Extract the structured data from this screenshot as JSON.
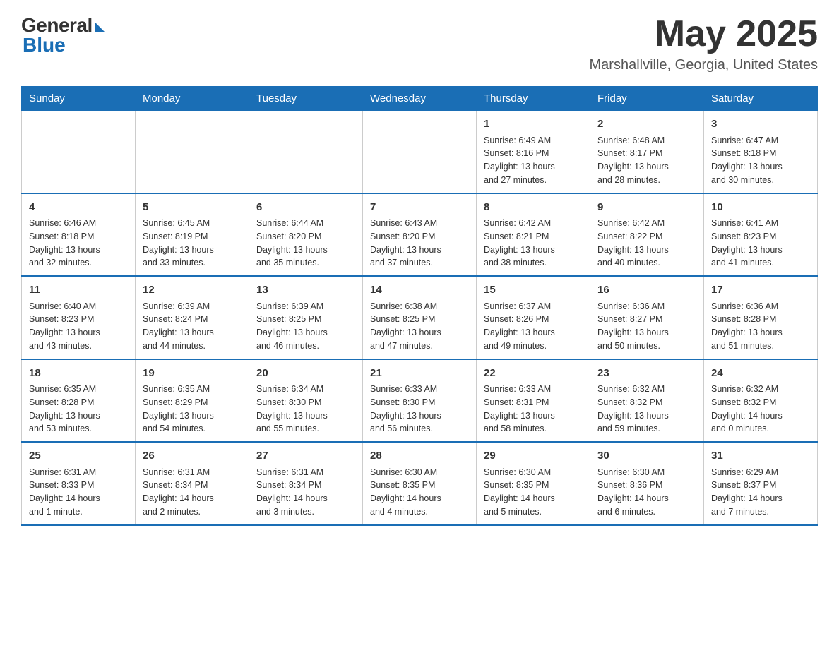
{
  "header": {
    "logo_general": "General",
    "logo_blue": "Blue",
    "month_year": "May 2025",
    "location": "Marshallville, Georgia, United States"
  },
  "days_of_week": [
    "Sunday",
    "Monday",
    "Tuesday",
    "Wednesday",
    "Thursday",
    "Friday",
    "Saturday"
  ],
  "weeks": [
    [
      {
        "day": "",
        "info": ""
      },
      {
        "day": "",
        "info": ""
      },
      {
        "day": "",
        "info": ""
      },
      {
        "day": "",
        "info": ""
      },
      {
        "day": "1",
        "info": "Sunrise: 6:49 AM\nSunset: 8:16 PM\nDaylight: 13 hours\nand 27 minutes."
      },
      {
        "day": "2",
        "info": "Sunrise: 6:48 AM\nSunset: 8:17 PM\nDaylight: 13 hours\nand 28 minutes."
      },
      {
        "day": "3",
        "info": "Sunrise: 6:47 AM\nSunset: 8:18 PM\nDaylight: 13 hours\nand 30 minutes."
      }
    ],
    [
      {
        "day": "4",
        "info": "Sunrise: 6:46 AM\nSunset: 8:18 PM\nDaylight: 13 hours\nand 32 minutes."
      },
      {
        "day": "5",
        "info": "Sunrise: 6:45 AM\nSunset: 8:19 PM\nDaylight: 13 hours\nand 33 minutes."
      },
      {
        "day": "6",
        "info": "Sunrise: 6:44 AM\nSunset: 8:20 PM\nDaylight: 13 hours\nand 35 minutes."
      },
      {
        "day": "7",
        "info": "Sunrise: 6:43 AM\nSunset: 8:20 PM\nDaylight: 13 hours\nand 37 minutes."
      },
      {
        "day": "8",
        "info": "Sunrise: 6:42 AM\nSunset: 8:21 PM\nDaylight: 13 hours\nand 38 minutes."
      },
      {
        "day": "9",
        "info": "Sunrise: 6:42 AM\nSunset: 8:22 PM\nDaylight: 13 hours\nand 40 minutes."
      },
      {
        "day": "10",
        "info": "Sunrise: 6:41 AM\nSunset: 8:23 PM\nDaylight: 13 hours\nand 41 minutes."
      }
    ],
    [
      {
        "day": "11",
        "info": "Sunrise: 6:40 AM\nSunset: 8:23 PM\nDaylight: 13 hours\nand 43 minutes."
      },
      {
        "day": "12",
        "info": "Sunrise: 6:39 AM\nSunset: 8:24 PM\nDaylight: 13 hours\nand 44 minutes."
      },
      {
        "day": "13",
        "info": "Sunrise: 6:39 AM\nSunset: 8:25 PM\nDaylight: 13 hours\nand 46 minutes."
      },
      {
        "day": "14",
        "info": "Sunrise: 6:38 AM\nSunset: 8:25 PM\nDaylight: 13 hours\nand 47 minutes."
      },
      {
        "day": "15",
        "info": "Sunrise: 6:37 AM\nSunset: 8:26 PM\nDaylight: 13 hours\nand 49 minutes."
      },
      {
        "day": "16",
        "info": "Sunrise: 6:36 AM\nSunset: 8:27 PM\nDaylight: 13 hours\nand 50 minutes."
      },
      {
        "day": "17",
        "info": "Sunrise: 6:36 AM\nSunset: 8:28 PM\nDaylight: 13 hours\nand 51 minutes."
      }
    ],
    [
      {
        "day": "18",
        "info": "Sunrise: 6:35 AM\nSunset: 8:28 PM\nDaylight: 13 hours\nand 53 minutes."
      },
      {
        "day": "19",
        "info": "Sunrise: 6:35 AM\nSunset: 8:29 PM\nDaylight: 13 hours\nand 54 minutes."
      },
      {
        "day": "20",
        "info": "Sunrise: 6:34 AM\nSunset: 8:30 PM\nDaylight: 13 hours\nand 55 minutes."
      },
      {
        "day": "21",
        "info": "Sunrise: 6:33 AM\nSunset: 8:30 PM\nDaylight: 13 hours\nand 56 minutes."
      },
      {
        "day": "22",
        "info": "Sunrise: 6:33 AM\nSunset: 8:31 PM\nDaylight: 13 hours\nand 58 minutes."
      },
      {
        "day": "23",
        "info": "Sunrise: 6:32 AM\nSunset: 8:32 PM\nDaylight: 13 hours\nand 59 minutes."
      },
      {
        "day": "24",
        "info": "Sunrise: 6:32 AM\nSunset: 8:32 PM\nDaylight: 14 hours\nand 0 minutes."
      }
    ],
    [
      {
        "day": "25",
        "info": "Sunrise: 6:31 AM\nSunset: 8:33 PM\nDaylight: 14 hours\nand 1 minute."
      },
      {
        "day": "26",
        "info": "Sunrise: 6:31 AM\nSunset: 8:34 PM\nDaylight: 14 hours\nand 2 minutes."
      },
      {
        "day": "27",
        "info": "Sunrise: 6:31 AM\nSunset: 8:34 PM\nDaylight: 14 hours\nand 3 minutes."
      },
      {
        "day": "28",
        "info": "Sunrise: 6:30 AM\nSunset: 8:35 PM\nDaylight: 14 hours\nand 4 minutes."
      },
      {
        "day": "29",
        "info": "Sunrise: 6:30 AM\nSunset: 8:35 PM\nDaylight: 14 hours\nand 5 minutes."
      },
      {
        "day": "30",
        "info": "Sunrise: 6:30 AM\nSunset: 8:36 PM\nDaylight: 14 hours\nand 6 minutes."
      },
      {
        "day": "31",
        "info": "Sunrise: 6:29 AM\nSunset: 8:37 PM\nDaylight: 14 hours\nand 7 minutes."
      }
    ]
  ]
}
